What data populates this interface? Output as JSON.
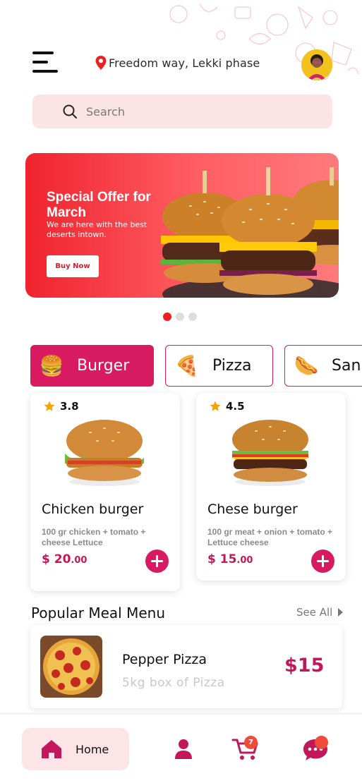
{
  "header": {
    "location": "Freedom way, Lekki phase",
    "menu_icon": "hamburger-menu-icon",
    "location_icon": "map-pin-icon"
  },
  "search": {
    "placeholder": "Search",
    "icon": "search-icon"
  },
  "banner": {
    "title": "Special Offer for March",
    "subtitle": "We are here with the best deserts intown.",
    "button_label": "Buy Now",
    "gradient_start": "#f0232e",
    "gradient_end": "#ff7a7c"
  },
  "carousel": {
    "total": 3,
    "active_index": 0
  },
  "categories": [
    {
      "label": "Burger",
      "icon": "🍔",
      "active": true
    },
    {
      "label": "Pizza",
      "icon": "🍕",
      "active": false
    },
    {
      "label": "Sandwich",
      "visible_label": "San",
      "icon": "🌭",
      "active": false
    }
  ],
  "food_cards": [
    {
      "rating": "3.8",
      "name": "Chicken burger",
      "description": "100 gr chicken + tomato + cheese  Lettuce",
      "price_main": "$ 20",
      "price_cents": ".00"
    },
    {
      "rating": "4.5",
      "name": "Chese burger",
      "description": "100 gr meat + onion + tomato + Lettuce cheese",
      "price_main": "$ 15",
      "price_cents": ".00"
    }
  ],
  "popular": {
    "title": "Popular Meal Menu",
    "see_all": "See All",
    "items": [
      {
        "name": "Pepper Pizza",
        "subtitle": "5kg box of Pizza",
        "price": "$15"
      }
    ]
  },
  "bottom_nav": {
    "home_label": "Home",
    "cart_count": "7"
  },
  "colors": {
    "accent": "#d81b60",
    "price": "#c2185b",
    "badge": "#f04a3a",
    "search_bg": "#fce4e4"
  }
}
